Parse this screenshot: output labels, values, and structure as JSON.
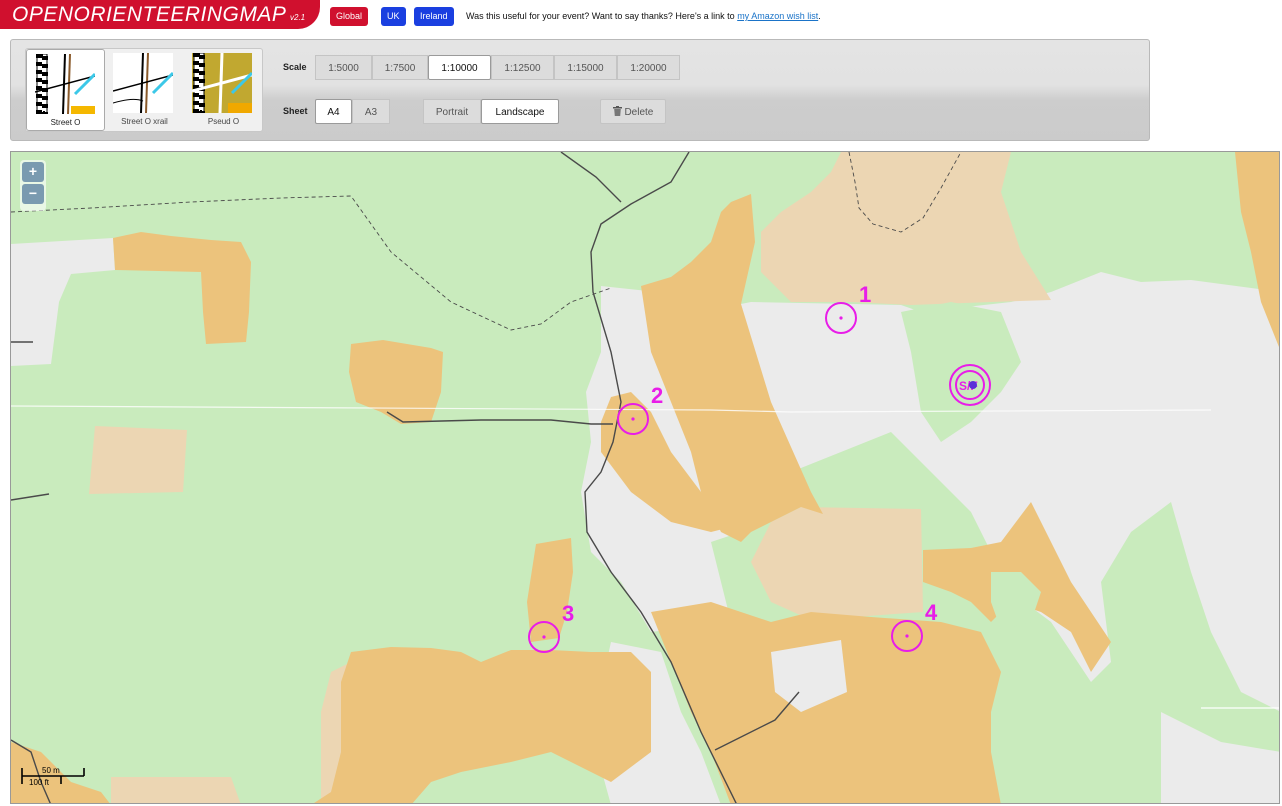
{
  "header": {
    "logo": "OPENORIENTEERINGMAP",
    "version": "v2.1",
    "buttons": [
      "Global",
      "UK",
      "Ireland"
    ],
    "thanks_text": "Was this useful for your event? Want to say thanks? Here's a link to ",
    "thanks_link": "my Amazon wish list",
    "thanks_end": "."
  },
  "styles": [
    {
      "label": "Street O",
      "selected": true
    },
    {
      "label": "Street O xrail",
      "selected": false
    },
    {
      "label": "Pseud O",
      "selected": false
    }
  ],
  "scale": {
    "label": "Scale",
    "options": [
      "1:5000",
      "1:7500",
      "1:10000",
      "1:12500",
      "1:15000",
      "1:20000"
    ],
    "selected": "1:10000"
  },
  "sheet": {
    "label": "Sheet",
    "options": [
      "A4",
      "A3"
    ],
    "selected": "A4"
  },
  "orientation": {
    "options": [
      "Portrait",
      "Landscape"
    ],
    "selected": "Landscape"
  },
  "delete_label": "Delete",
  "zoom": {
    "in": "+",
    "out": "−"
  },
  "scalebar": {
    "metric": "50 m",
    "imperial": "100 ft"
  },
  "controls": [
    {
      "number": "1"
    },
    {
      "number": "2"
    },
    {
      "number": "3"
    },
    {
      "number": "4"
    }
  ],
  "start_label": "S/F",
  "colors": {
    "brand_red": "#d0102e",
    "button_blue": "#1a3fe0",
    "open_land": "#c9ebbd",
    "rough_open": "#ecc37c",
    "light_rough": "#ecd6b3",
    "built_area": "#ebebeb",
    "control_magenta": "#e81de8"
  }
}
